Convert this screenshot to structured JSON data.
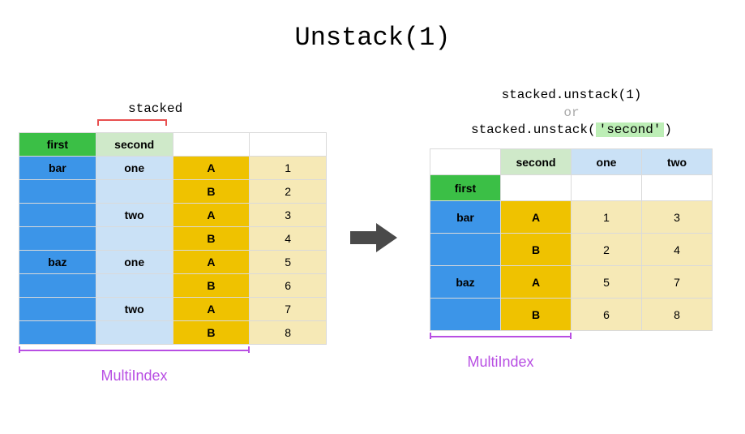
{
  "title": "Unstack(1)",
  "left": {
    "label_stacked": "stacked",
    "headers": {
      "first": "first",
      "second": "second"
    },
    "rows": [
      {
        "first": "bar",
        "second": "one",
        "col": "A",
        "val": "1"
      },
      {
        "first": "",
        "second": "",
        "col": "B",
        "val": "2"
      },
      {
        "first": "",
        "second": "two",
        "col": "A",
        "val": "3"
      },
      {
        "first": "",
        "second": "",
        "col": "B",
        "val": "4"
      },
      {
        "first": "baz",
        "second": "one",
        "col": "A",
        "val": "5"
      },
      {
        "first": "",
        "second": "",
        "col": "B",
        "val": "6"
      },
      {
        "first": "",
        "second": "two",
        "col": "A",
        "val": "7"
      },
      {
        "first": "",
        "second": "",
        "col": "B",
        "val": "8"
      }
    ],
    "multiindex_label": "MultiIndex"
  },
  "right": {
    "code1": "stacked.unstack(1)",
    "code_or": "or",
    "code2_pre": "stacked.unstack(",
    "code2_hl": "'second'",
    "code2_post": ")",
    "col_headers": {
      "second": "second",
      "one": "one",
      "two": "two"
    },
    "row_header_first": "first",
    "rows": [
      {
        "first": "bar",
        "col": "A",
        "one": "1",
        "two": "3"
      },
      {
        "first": "",
        "col": "B",
        "one": "2",
        "two": "4"
      },
      {
        "first": "baz",
        "col": "A",
        "one": "5",
        "two": "7"
      },
      {
        "first": "",
        "col": "B",
        "one": "6",
        "two": "8"
      }
    ],
    "multiindex_label": "MultiIndex"
  }
}
